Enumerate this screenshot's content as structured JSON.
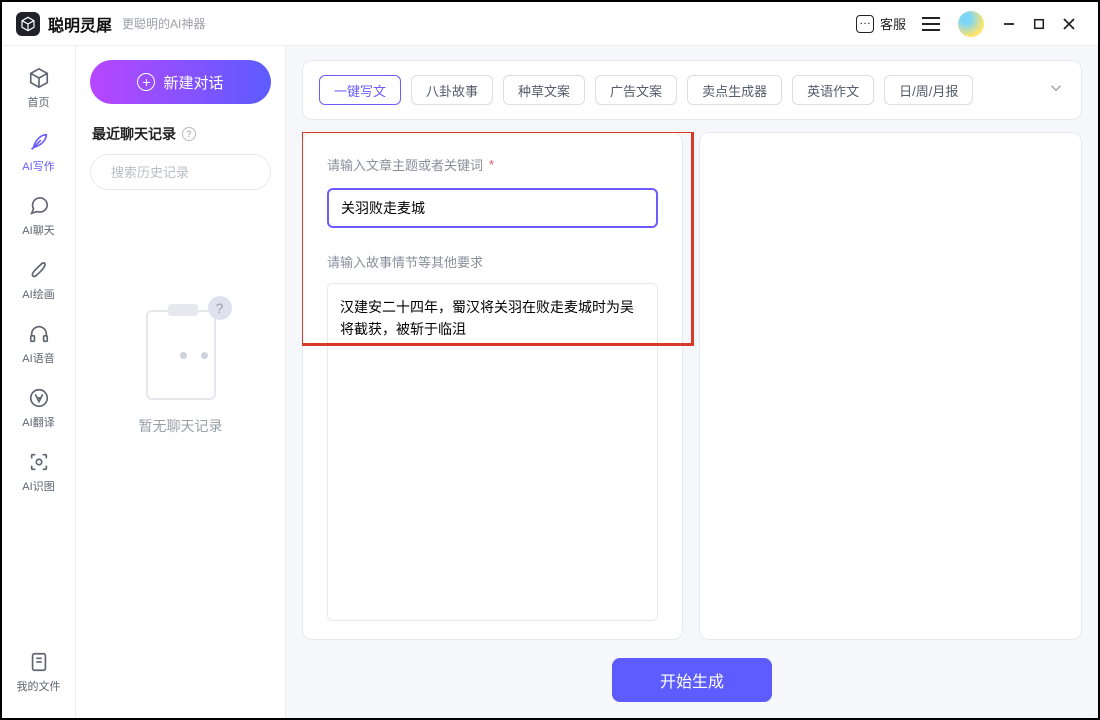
{
  "titlebar": {
    "appName": "聪明灵犀",
    "slogan": "更聪明的AI神器",
    "serviceLabel": "客服"
  },
  "rail": {
    "items": [
      {
        "label": "首页",
        "name": "home"
      },
      {
        "label": "AI写作",
        "name": "ai-write",
        "active": true
      },
      {
        "label": "AI聊天",
        "name": "ai-chat"
      },
      {
        "label": "AI绘画",
        "name": "ai-paint"
      },
      {
        "label": "AI语音",
        "name": "ai-voice"
      },
      {
        "label": "AI翻译",
        "name": "ai-translate"
      },
      {
        "label": "AI识图",
        "name": "ai-image-rec"
      }
    ],
    "bottom": {
      "label": "我的文件",
      "name": "my-files"
    }
  },
  "history": {
    "newChat": "新建对话",
    "title": "最近聊天记录",
    "searchPlaceholder": "搜索历史记录",
    "empty": "暂无聊天记录"
  },
  "tabs": [
    "一键写文",
    "八卦故事",
    "种草文案",
    "广告文案",
    "卖点生成器",
    "英语作文",
    "日/周/月报"
  ],
  "tabsActiveIndex": 0,
  "form": {
    "topicLabel": "请输入文章主题或者关键词",
    "topicValue": "关羽败走麦城",
    "detailLabel": "请输入故事情节等其他要求",
    "detailValue": "汉建安二十四年，蜀汉将关羽在败走麦城时为吴将截获，被斩于临沮"
  },
  "generateLabel": "开始生成",
  "colors": {
    "accent": "#6a5cff",
    "redHighlight": "#d83a2a"
  }
}
